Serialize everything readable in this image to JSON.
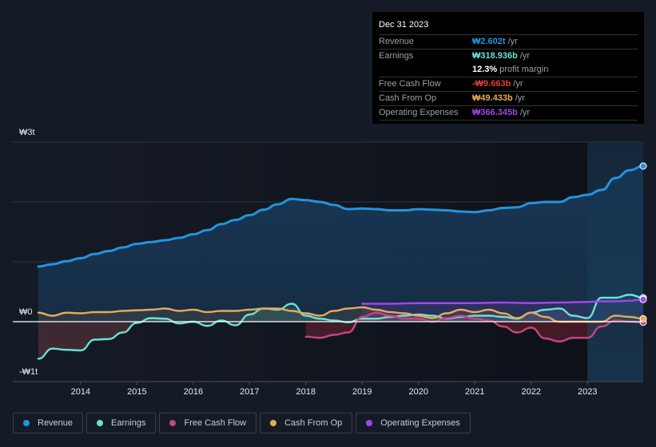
{
  "tooltip": {
    "date": "Dec 31 2023",
    "rows": [
      {
        "label": "Revenue",
        "value": "₩2.602t",
        "unit": "/yr",
        "color": "#2394df"
      },
      {
        "label": "Earnings",
        "value": "₩318.936b",
        "unit": "/yr",
        "color": "#6ce1d0"
      },
      {
        "label": "",
        "value": "12.3%",
        "unit": "profit margin",
        "color": "#ffffff"
      },
      {
        "label": "Free Cash Flow",
        "value": "-₩9.663b",
        "unit": "/yr",
        "color": "#e5383b"
      },
      {
        "label": "Cash From Op",
        "value": "₩49.433b",
        "unit": "/yr",
        "color": "#e8a955"
      },
      {
        "label": "Operating Expenses",
        "value": "₩366.345b",
        "unit": "/yr",
        "color": "#a245e8"
      }
    ]
  },
  "legend": [
    {
      "label": "Revenue",
      "color": "#2394df"
    },
    {
      "label": "Earnings",
      "color": "#6ce1d0"
    },
    {
      "label": "Free Cash Flow",
      "color": "#c4467f"
    },
    {
      "label": "Cash From Op",
      "color": "#e8a955"
    },
    {
      "label": "Operating Expenses",
      "color": "#a245e8"
    }
  ],
  "chart_data": {
    "type": "line",
    "title": "",
    "xlabel": "",
    "ylabel": "",
    "y_tick_labels": [
      "₩3t",
      "₩0",
      "-₩1t"
    ],
    "ylim": [
      -1.0,
      3.0
    ],
    "y_unit": "trillion KRW",
    "xlim": [
      2013.25,
      2023.99
    ],
    "x_tick_labels": [
      "2014",
      "2015",
      "2016",
      "2017",
      "2018",
      "2019",
      "2020",
      "2021",
      "2022",
      "2023"
    ],
    "grid": true,
    "legend_position": "bottom-left",
    "highlight_region_start": 2023.0,
    "series": [
      {
        "name": "Revenue",
        "color": "#2394df",
        "x": [
          2013.25,
          2013.5,
          2013.75,
          2014.0,
          2014.25,
          2014.5,
          2014.75,
          2015.0,
          2015.25,
          2015.5,
          2015.75,
          2016.0,
          2016.25,
          2016.5,
          2016.75,
          2017.0,
          2017.25,
          2017.5,
          2017.75,
          2018.0,
          2018.25,
          2018.5,
          2018.75,
          2019.0,
          2019.25,
          2019.5,
          2019.75,
          2020.0,
          2020.25,
          2020.5,
          2020.75,
          2021.0,
          2021.25,
          2021.5,
          2021.75,
          2022.0,
          2022.25,
          2022.5,
          2022.75,
          2023.0,
          2023.25,
          2023.5,
          2023.75,
          2023.99
        ],
        "values": [
          0.92,
          0.96,
          1.01,
          1.06,
          1.13,
          1.18,
          1.24,
          1.3,
          1.33,
          1.36,
          1.4,
          1.46,
          1.53,
          1.63,
          1.7,
          1.78,
          1.87,
          1.96,
          2.05,
          2.03,
          2.0,
          1.95,
          1.88,
          1.89,
          1.88,
          1.86,
          1.86,
          1.88,
          1.87,
          1.86,
          1.84,
          1.83,
          1.86,
          1.9,
          1.91,
          1.98,
          2.0,
          2.0,
          2.08,
          2.12,
          2.2,
          2.4,
          2.53,
          2.6
        ]
      },
      {
        "name": "Earnings",
        "color": "#6ce1d0",
        "x": [
          2013.25,
          2013.5,
          2013.75,
          2014.0,
          2014.25,
          2014.5,
          2014.75,
          2015.0,
          2015.25,
          2015.5,
          2015.75,
          2016.0,
          2016.25,
          2016.5,
          2016.75,
          2017.0,
          2017.25,
          2017.5,
          2017.75,
          2018.0,
          2018.25,
          2018.5,
          2018.75,
          2019.0,
          2019.25,
          2019.5,
          2019.75,
          2020.0,
          2020.25,
          2020.5,
          2020.75,
          2021.0,
          2021.25,
          2021.5,
          2021.75,
          2022.0,
          2022.25,
          2022.5,
          2022.75,
          2023.0,
          2023.25,
          2023.5,
          2023.75,
          2023.99
        ],
        "values": [
          -0.62,
          -0.45,
          -0.47,
          -0.48,
          -0.3,
          -0.29,
          -0.18,
          -0.02,
          0.06,
          0.05,
          -0.03,
          0.0,
          -0.07,
          0.02,
          -0.06,
          0.12,
          0.22,
          0.2,
          0.3,
          0.1,
          0.05,
          0.02,
          -0.01,
          0.05,
          0.05,
          0.08,
          0.1,
          0.12,
          0.1,
          0.05,
          0.08,
          0.1,
          0.1,
          0.08,
          0.05,
          0.15,
          0.2,
          0.22,
          0.1,
          0.06,
          0.4,
          0.4,
          0.45,
          0.4
        ]
      },
      {
        "name": "Free Cash Flow",
        "color": "#c4467f",
        "x": [
          2018.0,
          2018.25,
          2018.5,
          2018.75,
          2019.0,
          2019.25,
          2019.5,
          2019.75,
          2020.0,
          2020.25,
          2020.5,
          2020.75,
          2021.0,
          2021.25,
          2021.5,
          2021.75,
          2022.0,
          2022.25,
          2022.5,
          2022.75,
          2023.0,
          2023.25,
          2023.5,
          2023.75,
          2023.99
        ],
        "values": [
          -0.25,
          -0.27,
          -0.22,
          -0.18,
          0.08,
          0.15,
          0.1,
          0.05,
          0.05,
          0.0,
          0.06,
          0.1,
          0.05,
          0.02,
          -0.08,
          -0.18,
          -0.1,
          -0.28,
          -0.33,
          -0.27,
          -0.27,
          -0.08,
          0.02,
          0.0,
          -0.01
        ]
      },
      {
        "name": "Cash From Op",
        "color": "#e8a955",
        "x": [
          2013.25,
          2013.5,
          2013.75,
          2014.0,
          2014.25,
          2014.5,
          2014.75,
          2015.0,
          2015.25,
          2015.5,
          2015.75,
          2016.0,
          2016.25,
          2016.5,
          2016.75,
          2017.0,
          2017.25,
          2017.5,
          2017.75,
          2018.0,
          2018.25,
          2018.5,
          2018.75,
          2019.0,
          2019.25,
          2019.5,
          2019.75,
          2020.0,
          2020.25,
          2020.5,
          2020.75,
          2021.0,
          2021.25,
          2021.5,
          2021.75,
          2022.0,
          2022.25,
          2022.5,
          2022.75,
          2023.0,
          2023.25,
          2023.5,
          2023.75,
          2023.99
        ],
        "values": [
          0.15,
          0.1,
          0.15,
          0.14,
          0.16,
          0.16,
          0.18,
          0.19,
          0.2,
          0.22,
          0.18,
          0.2,
          0.16,
          0.18,
          0.18,
          0.2,
          0.22,
          0.22,
          0.18,
          0.14,
          0.1,
          0.18,
          0.22,
          0.24,
          0.2,
          0.16,
          0.14,
          0.1,
          0.06,
          0.14,
          0.2,
          0.16,
          0.2,
          0.14,
          0.06,
          0.15,
          0.08,
          0.0,
          0.0,
          0.0,
          0.0,
          0.1,
          0.08,
          0.05
        ]
      },
      {
        "name": "Operating Expenses",
        "color": "#a245e8",
        "x": [
          2019.0,
          2019.5,
          2020.0,
          2020.5,
          2021.0,
          2021.5,
          2022.0,
          2022.5,
          2023.0,
          2023.25,
          2023.5,
          2023.75,
          2023.99
        ],
        "values": [
          0.3,
          0.3,
          0.31,
          0.31,
          0.31,
          0.32,
          0.31,
          0.32,
          0.33,
          0.34,
          0.34,
          0.35,
          0.37
        ]
      }
    ]
  }
}
